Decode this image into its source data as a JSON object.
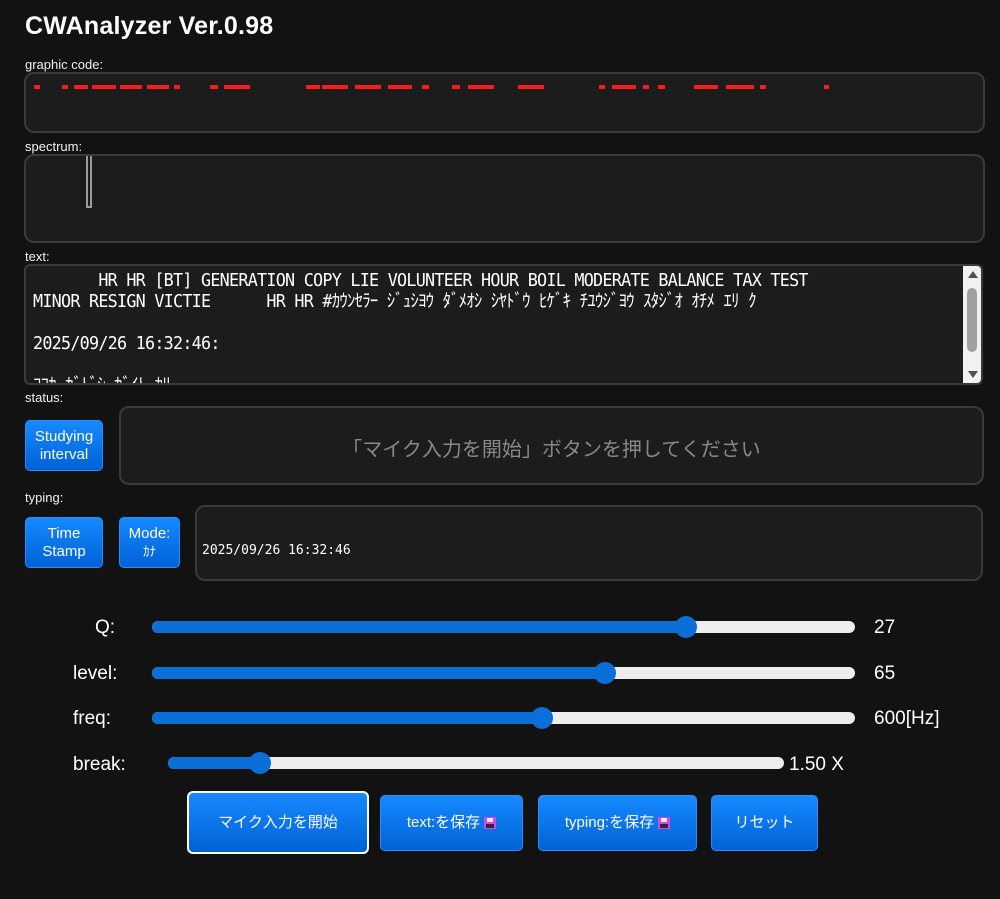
{
  "app": {
    "title": "CWAnalyzer Ver.0.98"
  },
  "labels": {
    "graphic_code": "graphic code:",
    "spectrum": "spectrum:",
    "text": "text:",
    "status": "status:",
    "typing": "typing:"
  },
  "text_area": {
    "line1": "       HR HR [BT] GENERATION COPY LIE VOLUNTEER HOUR BOIL MODERATE BALANCE TAX TEST",
    "line2": "MINOR RESIGN VICTIE      HR HR #ｶｳﾝｾﾗｰ ｼﾞｭｼﾖｳ ﾀﾞﾒｵｼ ｼﾔﾄﾞｳ ﾋｹﾞｷ ﾁﾕｳｼﾞﾖｳ ｽﾀｼﾞｵ ｵﾁﾒ ｴﾘ ｸ",
    "line3": "",
    "line4": "2025/09/26 16:32:46:",
    "line5": "",
    "line6": "ｺｺｶ ｶﾞﾄﾞｼ ｶﾞｲﾄ ｶﾘｰ"
  },
  "buttons": {
    "studying_interval_1": "Studying",
    "studying_interval_2": "interval",
    "time_stamp_1": "Time",
    "time_stamp_2": "Stamp",
    "mode_1": "Mode:",
    "mode_2": "ｶﾅ",
    "start_mic": "マイク入力を開始",
    "save_text": "text:を保存",
    "save_typing": "typing:を保存",
    "reset": "リセット"
  },
  "status": {
    "message": "「マイク入力を開始」ボタンを押してください"
  },
  "typing": {
    "value": "2025/09/26 16:32:46"
  },
  "sliders": {
    "q": {
      "label": "Q:",
      "value": "27",
      "fraction": 0.76
    },
    "level": {
      "label": "level:",
      "value": "65",
      "fraction": 0.645
    },
    "freq": {
      "label": "freq:",
      "value": "600[Hz]",
      "fraction": 0.555
    },
    "break": {
      "label": "break:",
      "value": "1.50 X",
      "fraction": 0.15
    }
  },
  "icons": {
    "save": "floppy-disk-icon"
  },
  "colors": {
    "accent": "#0a6fd6",
    "code_mark": "#ff1a1a",
    "background": "#121212"
  }
}
